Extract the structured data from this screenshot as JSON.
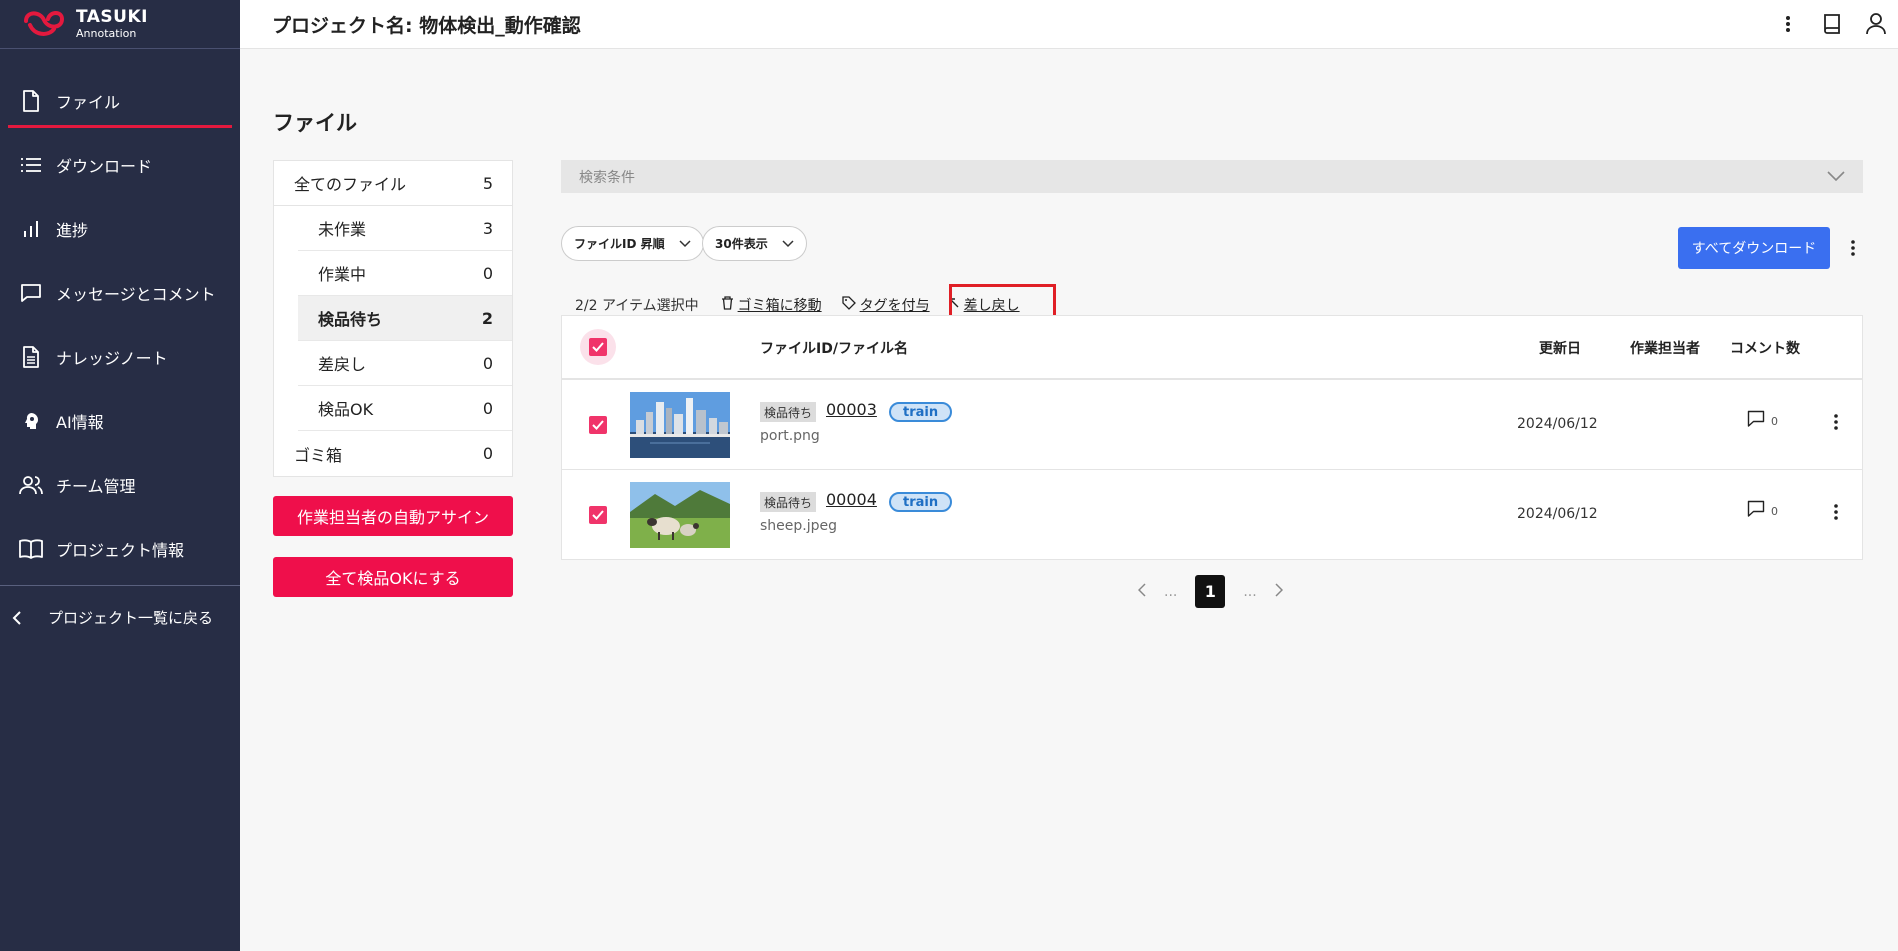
{
  "app": {
    "logo_line1": "TASUKI",
    "logo_line2": "Annotation"
  },
  "sidebar": {
    "items": [
      {
        "label": "ファイル",
        "icon": "file-icon",
        "active": true
      },
      {
        "label": "ダウンロード",
        "icon": "list-icon"
      },
      {
        "label": "進捗",
        "icon": "chart-icon"
      },
      {
        "label": "メッセージとコメント",
        "icon": "message-icon"
      },
      {
        "label": "ナレッジノート",
        "icon": "document-icon"
      },
      {
        "label": "AI情報",
        "icon": "ai-head-icon"
      },
      {
        "label": "チーム管理",
        "icon": "team-icon"
      },
      {
        "label": "プロジェクト情報",
        "icon": "book-icon"
      }
    ],
    "back_label": "プロジェクト一覧に戻る"
  },
  "header": {
    "title": "プロジェクト名: 物体検出_動作確認"
  },
  "page": {
    "heading": "ファイル"
  },
  "filters": {
    "all": {
      "label": "全てのファイル",
      "count": "5"
    },
    "sub": [
      {
        "label": "未作業",
        "count": "3"
      },
      {
        "label": "作業中",
        "count": "0"
      },
      {
        "label": "検品待ち",
        "count": "2",
        "selected": true
      },
      {
        "label": "差戻し",
        "count": "0"
      },
      {
        "label": "検品OK",
        "count": "0"
      }
    ],
    "trash": {
      "label": "ゴミ箱",
      "count": "0"
    }
  },
  "buttons": {
    "auto_assign": "作業担当者の自動アサイン",
    "all_ok": "全て検品OKにする",
    "download_all": "すべてダウンロード"
  },
  "search": {
    "label": "検索条件"
  },
  "sort": {
    "selected": "ファイルID 昇順"
  },
  "per_page": {
    "selected": "30件表示"
  },
  "actions": {
    "selection": "2/2 アイテム選択中",
    "trash": "ゴミ箱に移動",
    "tag": "タグを付与",
    "return": "差し戻し"
  },
  "table": {
    "headers": {
      "file": "ファイルID/ファイル名",
      "updated": "更新日",
      "assignee": "作業担当者",
      "comments": "コメント数"
    },
    "rows": [
      {
        "status": "検品待ち",
        "id": "00003",
        "tag": "train",
        "filename": "port.png",
        "date": "2024/06/12",
        "comments": "0",
        "checked": true
      },
      {
        "status": "検品待ち",
        "id": "00004",
        "tag": "train",
        "filename": "sheep.jpeg",
        "date": "2024/06/12",
        "comments": "0",
        "checked": true
      }
    ]
  },
  "pagination": {
    "current": "1",
    "ellipsis": "..."
  },
  "colors": {
    "sidebar": "#272d45",
    "accent_red": "#ef0f4b",
    "primary_blue": "#3a6ff0",
    "checkbox": "#f0346a"
  }
}
